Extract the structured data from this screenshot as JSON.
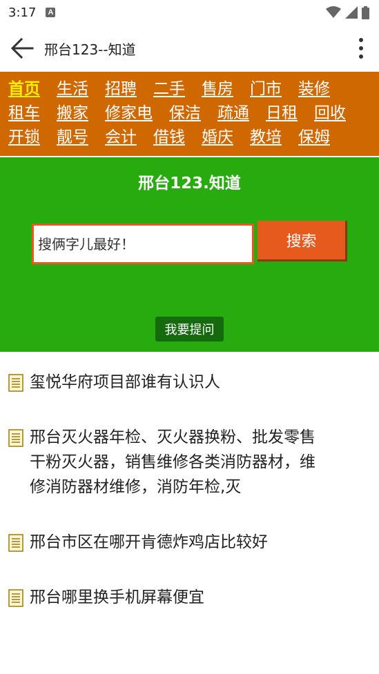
{
  "status_bar": {
    "time": "3:17",
    "notification_icon": "A"
  },
  "app_bar": {
    "title": "邢台123--知道",
    "back_icon": "arrow-left-icon",
    "menu_icon": "more-vert-icon"
  },
  "categories": [
    [
      "首页",
      "生活",
      "招聘",
      "二手",
      "售房",
      "门市",
      "装修"
    ],
    [
      "租车",
      "搬家",
      "修家电",
      "保洁",
      "疏通",
      "日租",
      "回收"
    ],
    [
      "开锁",
      "靓号",
      "会计",
      "借钱",
      "婚庆",
      "教培",
      "保姆"
    ]
  ],
  "search": {
    "site_title": "邢台123.知道",
    "placeholder": "搜俩字儿最好！",
    "value": "",
    "button_label": "搜索",
    "ask_label": "我要提问"
  },
  "questions": [
    {
      "text": "玺悦华府项目部谁有认识人"
    },
    {
      "text": "邢台灭火器年检、灭火器换粉、批发零售干粉灭火器，销售维修各类消防器材，维修消防器材维修，消防年检,灭"
    },
    {
      "text": "邢台市区在哪开肯德炸鸡店比较好"
    },
    {
      "text": "邢台哪里换手机屏幕便宜"
    }
  ],
  "colors": {
    "nav_bg": "#d06800",
    "nav_active": "#ffee00",
    "search_bg": "#27ab0f",
    "search_accent": "#e65a1e",
    "ask_bg": "#146a0c"
  }
}
